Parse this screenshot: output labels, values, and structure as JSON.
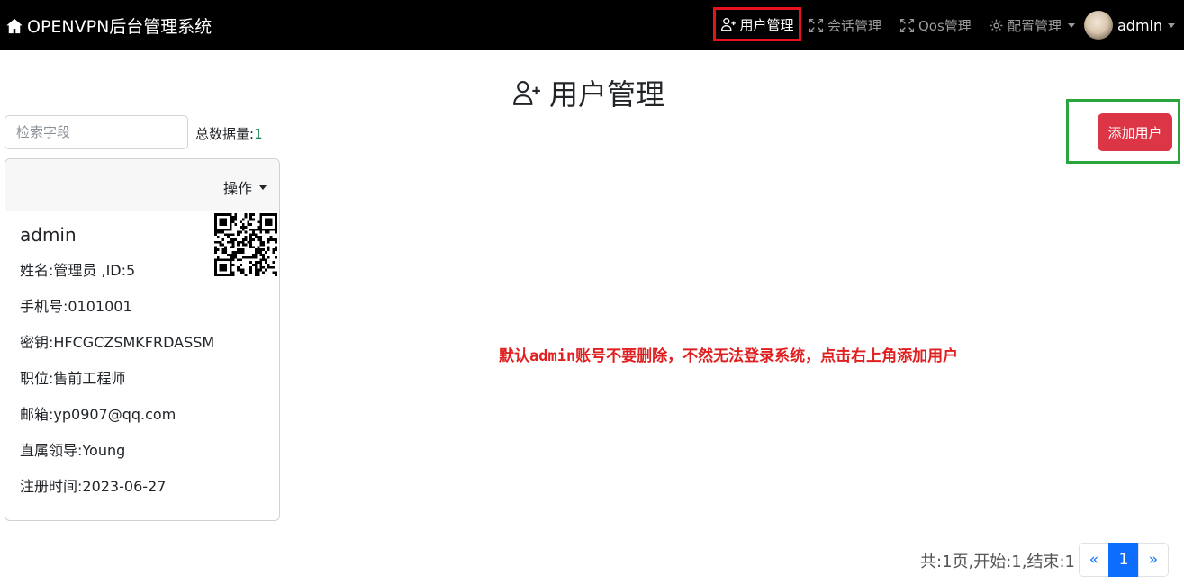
{
  "navbar": {
    "brand": "OPENVPN后台管理系统",
    "items": [
      {
        "label": "用户管理",
        "icon": "person-plus-icon",
        "active": true
      },
      {
        "label": "会话管理",
        "icon": "fullscreen-icon"
      },
      {
        "label": "Qos管理",
        "icon": "fullscreen-icon"
      },
      {
        "label": "配置管理",
        "icon": "gear-icon"
      }
    ],
    "user": "admin"
  },
  "page": {
    "title": "用户管理",
    "search_placeholder": "检索字段",
    "total_label": "总数据量:",
    "total_value": "1",
    "add_button": "添加用户"
  },
  "card": {
    "ops_label": "操作",
    "username": "admin",
    "fields": [
      "姓名:管理员 ,ID:5",
      "手机号:0101001",
      "密钥:HFCGCZSMKFRDASSM",
      "职位:售前工程师",
      "邮箱:yp0907@qq.com",
      "直属领导:Young",
      "注册时间:2023-06-27"
    ]
  },
  "notice": "默认admin账号不要删除，不然无法登录系统，点击右上角添加用户",
  "pagination": {
    "info": "共:1页,开始:1,结束:1",
    "prev": "«",
    "current": "1",
    "next": "»"
  },
  "colors": {
    "navbar_bg": "#000000",
    "danger": "#dc3545",
    "primary": "#0d6efd",
    "notice": "#e02020",
    "highlight_red": "#e8121b",
    "highlight_green": "#2aa53e"
  }
}
